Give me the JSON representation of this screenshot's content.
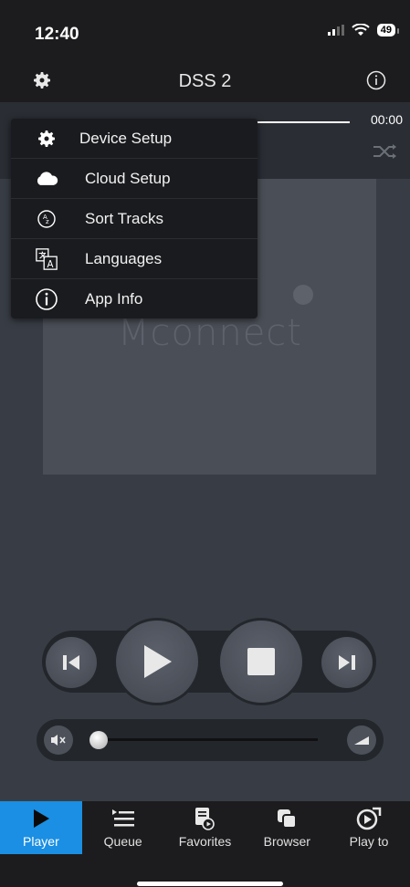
{
  "status_bar": {
    "time": "12:40",
    "battery": "49"
  },
  "header": {
    "title": "DSS 2"
  },
  "player": {
    "time_end": "00:00",
    "logo_text": "MCONNECT"
  },
  "menu": {
    "items": [
      {
        "label": "Device Setup",
        "icon": "gear-icon"
      },
      {
        "label": "Cloud Setup",
        "icon": "cloud-icon"
      },
      {
        "label": "Sort Tracks",
        "icon": "sort-az-icon"
      },
      {
        "label": "Languages",
        "icon": "language-icon"
      },
      {
        "label": "App Info",
        "icon": "info-icon"
      }
    ]
  },
  "volume": {
    "level": 0
  },
  "tabs": [
    {
      "label": "Player",
      "active": true
    },
    {
      "label": "Queue",
      "active": false
    },
    {
      "label": "Favorites",
      "active": false
    },
    {
      "label": "Browser",
      "active": false
    },
    {
      "label": "Play to",
      "active": false
    }
  ],
  "colors": {
    "accent": "#1a8fe3",
    "background": "#383d45"
  }
}
